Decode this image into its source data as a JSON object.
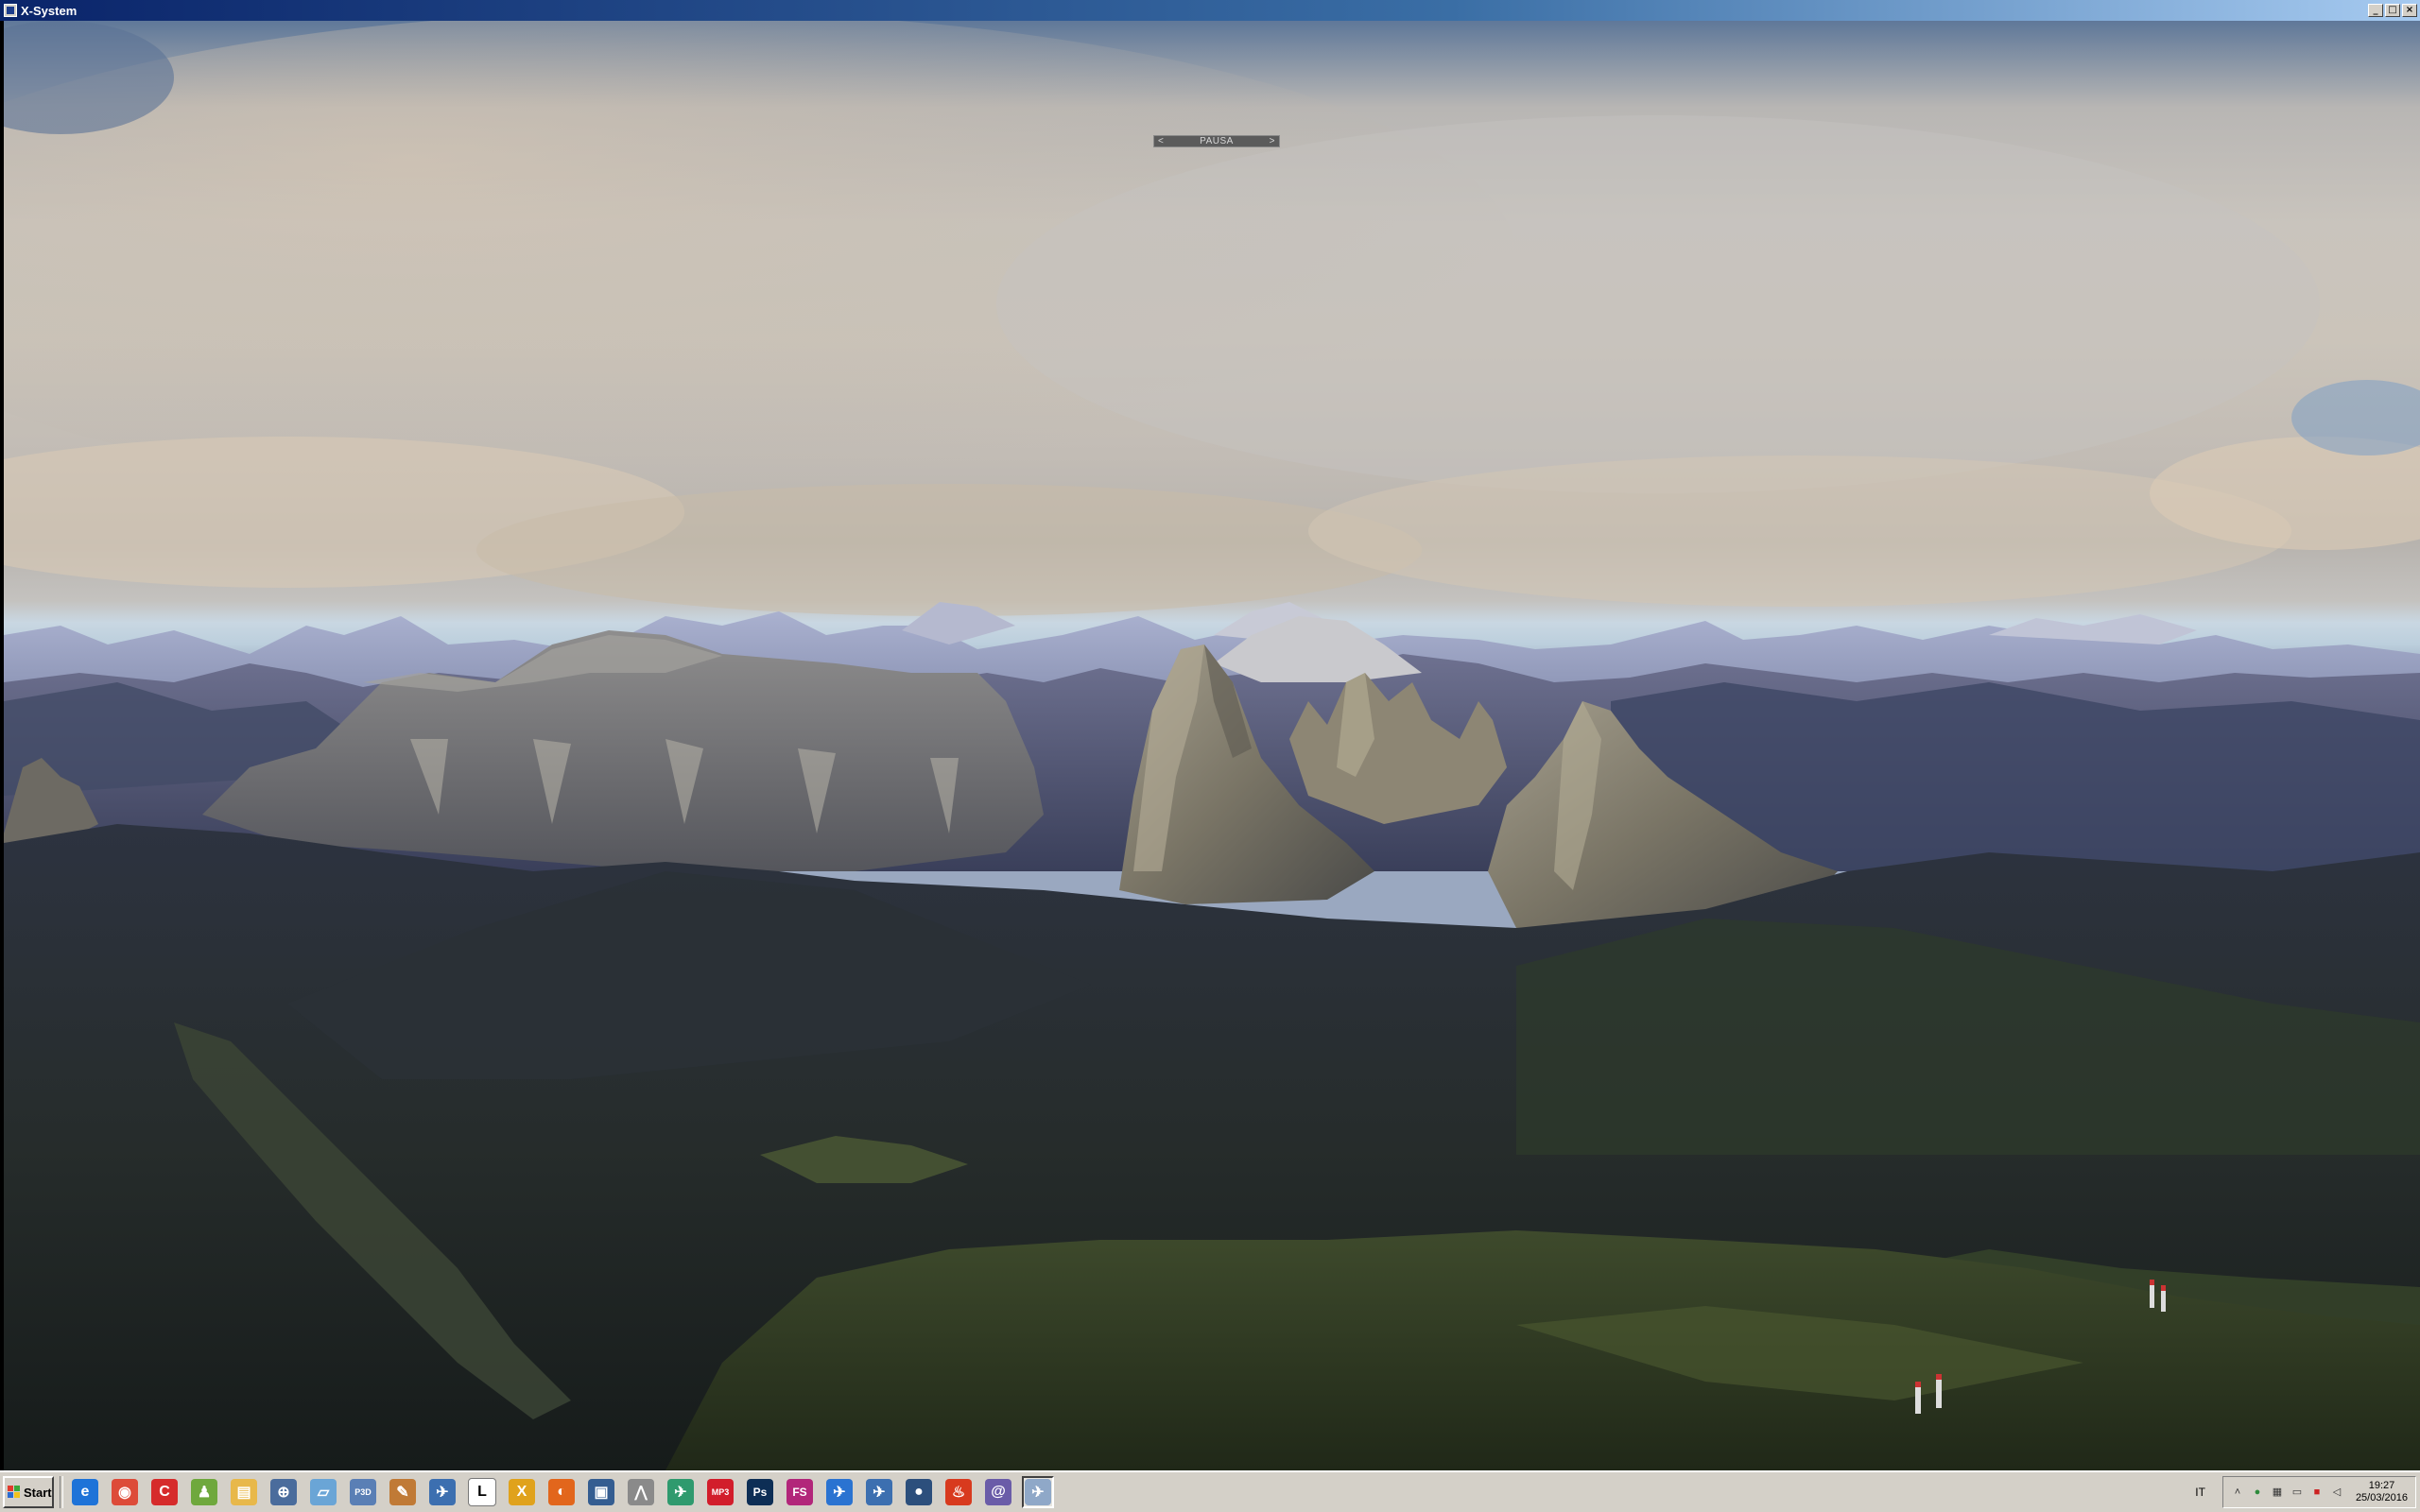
{
  "window": {
    "title": "X-System",
    "buttons": {
      "minimize": "_",
      "maximize": "□",
      "close": "×"
    }
  },
  "sim": {
    "pause_label": "PAUSA",
    "prev_arrow": "<",
    "next_arrow": ">"
  },
  "taskbar": {
    "start_label": "Start",
    "quick_launch": [
      {
        "name": "internet-explorer-icon",
        "color": "#1e73d8",
        "glyph": "e"
      },
      {
        "name": "chrome-icon",
        "color": "#dd4b39",
        "glyph": "◉"
      },
      {
        "name": "ccleaner-icon",
        "color": "#d62b2b",
        "glyph": "C"
      },
      {
        "name": "android-icon",
        "color": "#6fa83d",
        "glyph": "♟"
      },
      {
        "name": "folder-icon",
        "color": "#e8b84a",
        "glyph": "▤"
      },
      {
        "name": "network-globe-icon",
        "color": "#4a6c9c",
        "glyph": "⊕"
      },
      {
        "name": "notepad-icon",
        "color": "#6aa5d6",
        "glyph": "▱"
      },
      {
        "name": "p3d-icon",
        "color": "#5a7fb5",
        "glyph": "P3D"
      },
      {
        "name": "paint-palette-icon",
        "color": "#c07a36",
        "glyph": "✎"
      },
      {
        "name": "aircraft-folder-icon",
        "color": "#3c6fb0",
        "glyph": "✈"
      },
      {
        "name": "document-l-icon",
        "color": "#ffffff",
        "glyph": "L"
      },
      {
        "name": "x-plane-icon",
        "color": "#e0a21c",
        "glyph": "X"
      },
      {
        "name": "firefox-icon",
        "color": "#e2661c",
        "glyph": "◐"
      },
      {
        "name": "monitor-icon",
        "color": "#345d91",
        "glyph": "▣"
      },
      {
        "name": "tool-icon",
        "color": "#8a8a8a",
        "glyph": "⋀"
      },
      {
        "name": "plane-green-icon",
        "color": "#2f9a6e",
        "glyph": "✈"
      },
      {
        "name": "mp3-icon",
        "color": "#d21d2b",
        "glyph": "MP3"
      },
      {
        "name": "photoshop-icon",
        "color": "#0d2e55",
        "glyph": "Ps"
      },
      {
        "name": "fs-icon",
        "color": "#b2267a",
        "glyph": "FS"
      },
      {
        "name": "airplane-blue-icon",
        "color": "#2a73d1",
        "glyph": "✈"
      },
      {
        "name": "aircraft-folder-2-icon",
        "color": "#3c6fb0",
        "glyph": "✈"
      },
      {
        "name": "globe-icon",
        "color": "#2c4f7c",
        "glyph": "●"
      },
      {
        "name": "flame-icon",
        "color": "#d83a1e",
        "glyph": "♨"
      },
      {
        "name": "swirl-icon",
        "color": "#6a5ca8",
        "glyph": "@"
      },
      {
        "name": "x-system-app-icon",
        "color": "#8fa8c8",
        "glyph": "✈"
      }
    ],
    "language": "IT",
    "clock_time": "19:27",
    "clock_date": "25/03/2016"
  }
}
